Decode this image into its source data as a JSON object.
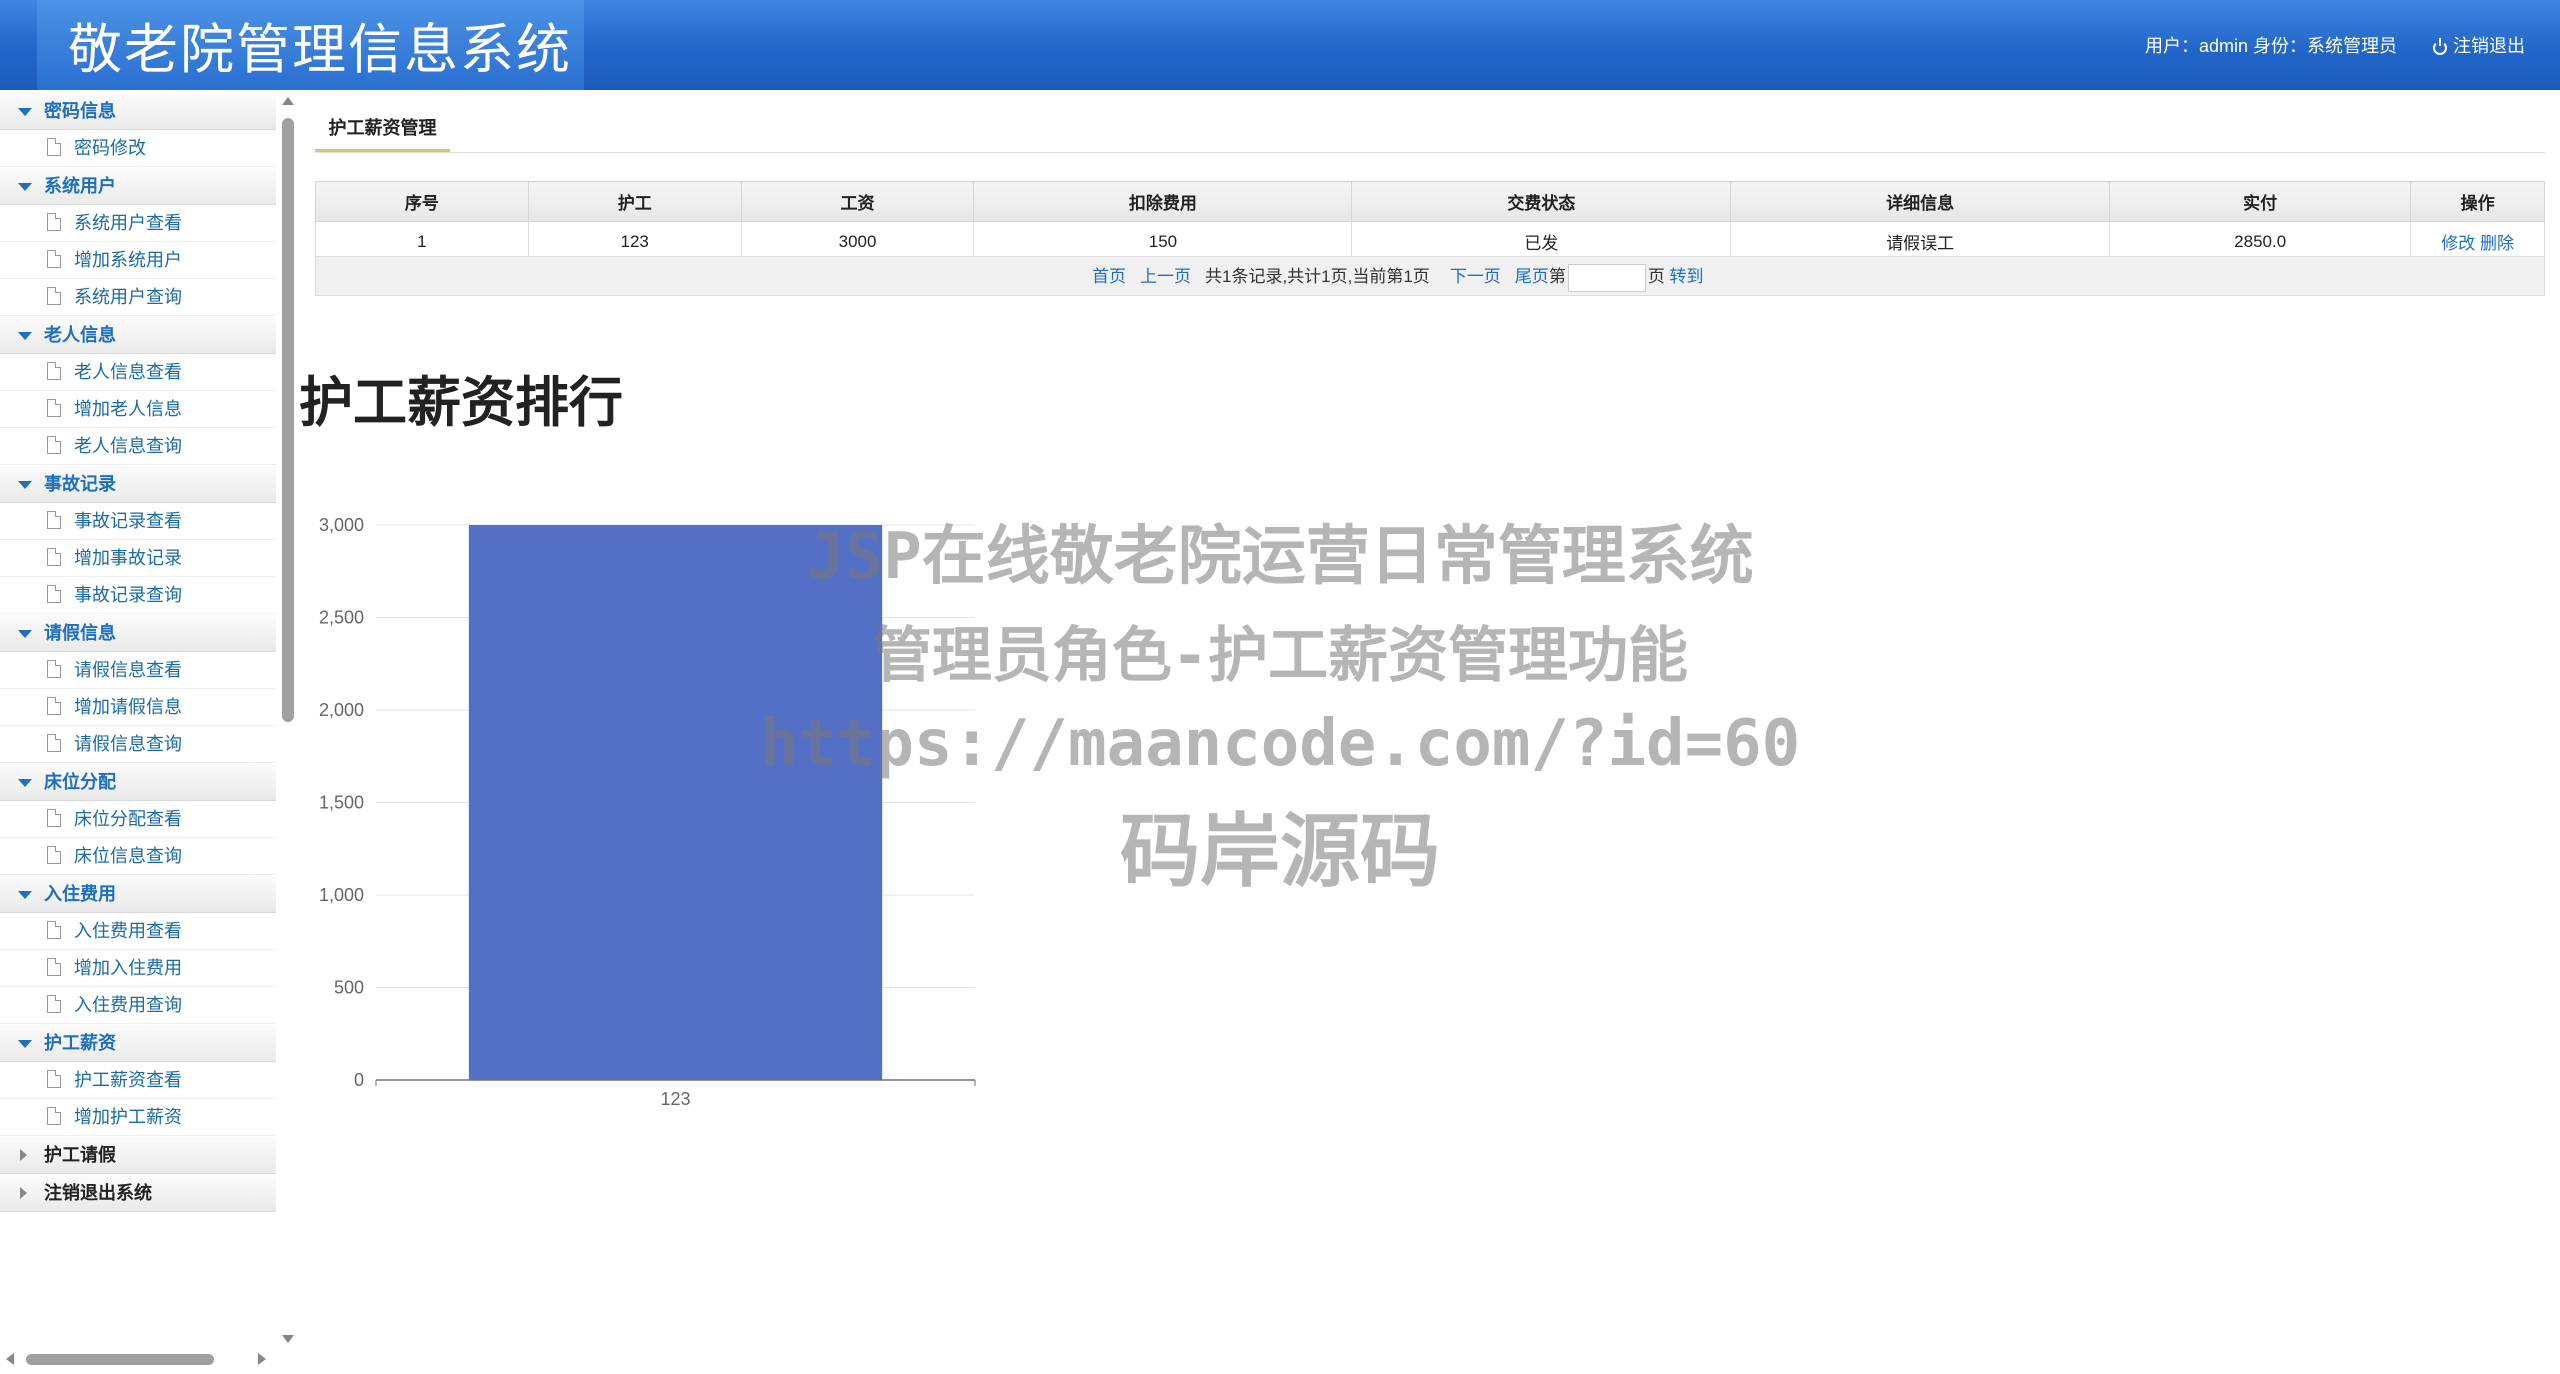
{
  "header": {
    "title": "敬老院管理信息系统",
    "user_info": "用户：admin 身份：系统管理员",
    "logout": "注销退出"
  },
  "sidebar": {
    "groups": [
      {
        "label": "密码信息",
        "items": [
          "密码修改"
        ]
      },
      {
        "label": "系统用户",
        "items": [
          "系统用户查看",
          "增加系统用户",
          "系统用户查询"
        ]
      },
      {
        "label": "老人信息",
        "items": [
          "老人信息查看",
          "增加老人信息",
          "老人信息查询"
        ]
      },
      {
        "label": "事故记录",
        "items": [
          "事故记录查看",
          "增加事故记录",
          "事故记录查询"
        ]
      },
      {
        "label": "请假信息",
        "items": [
          "请假信息查看",
          "增加请假信息",
          "请假信息查询"
        ]
      },
      {
        "label": "床位分配",
        "items": [
          "床位分配查看",
          "床位信息查询"
        ]
      },
      {
        "label": "入住费用",
        "items": [
          "入住费用查看",
          "增加入住费用",
          "入住费用查询"
        ]
      },
      {
        "label": "护工薪资",
        "items": [
          "护工薪资查看",
          "增加护工薪资"
        ]
      },
      {
        "label": "护工请假",
        "items": []
      },
      {
        "label": "注销退出系统",
        "items": []
      }
    ]
  },
  "main": {
    "tab": "护工薪资管理",
    "table": {
      "headers": [
        "序号",
        "护工",
        "工资",
        "扣除费用",
        "交费状态",
        "详细信息",
        "实付",
        "操作"
      ],
      "rows": [
        {
          "no": "1",
          "worker": "123",
          "salary": "3000",
          "deduct": "150",
          "status": "已发",
          "detail": "请假误工",
          "paid": "2850.0",
          "edit": "修改",
          "delete": "删除"
        }
      ]
    },
    "pager": {
      "first": "首页",
      "prev": "上一页",
      "summary": "共1条记录,共计1页,当前第1页",
      "next": "下一页",
      "last": "尾页",
      "goto_prefix": "第",
      "goto_suffix": "页",
      "goto": "转到"
    },
    "ranking_title": "护工薪资排行"
  },
  "chart_data": {
    "type": "bar",
    "categories": [
      "123"
    ],
    "values": [
      3000
    ],
    "ylim": [
      0,
      3000
    ],
    "yticks": [
      "0",
      "500",
      "1,000",
      "1,500",
      "2,000",
      "2,500",
      "3,000"
    ],
    "bar_color": "#5470c6",
    "grid": true
  },
  "watermark": {
    "line1": "JSP在线敬老院运营日常管理系统",
    "line2": "管理员角色-护工薪资管理功能",
    "line3": "https://maancode.com/?id=60",
    "line4": "码岸源码"
  }
}
